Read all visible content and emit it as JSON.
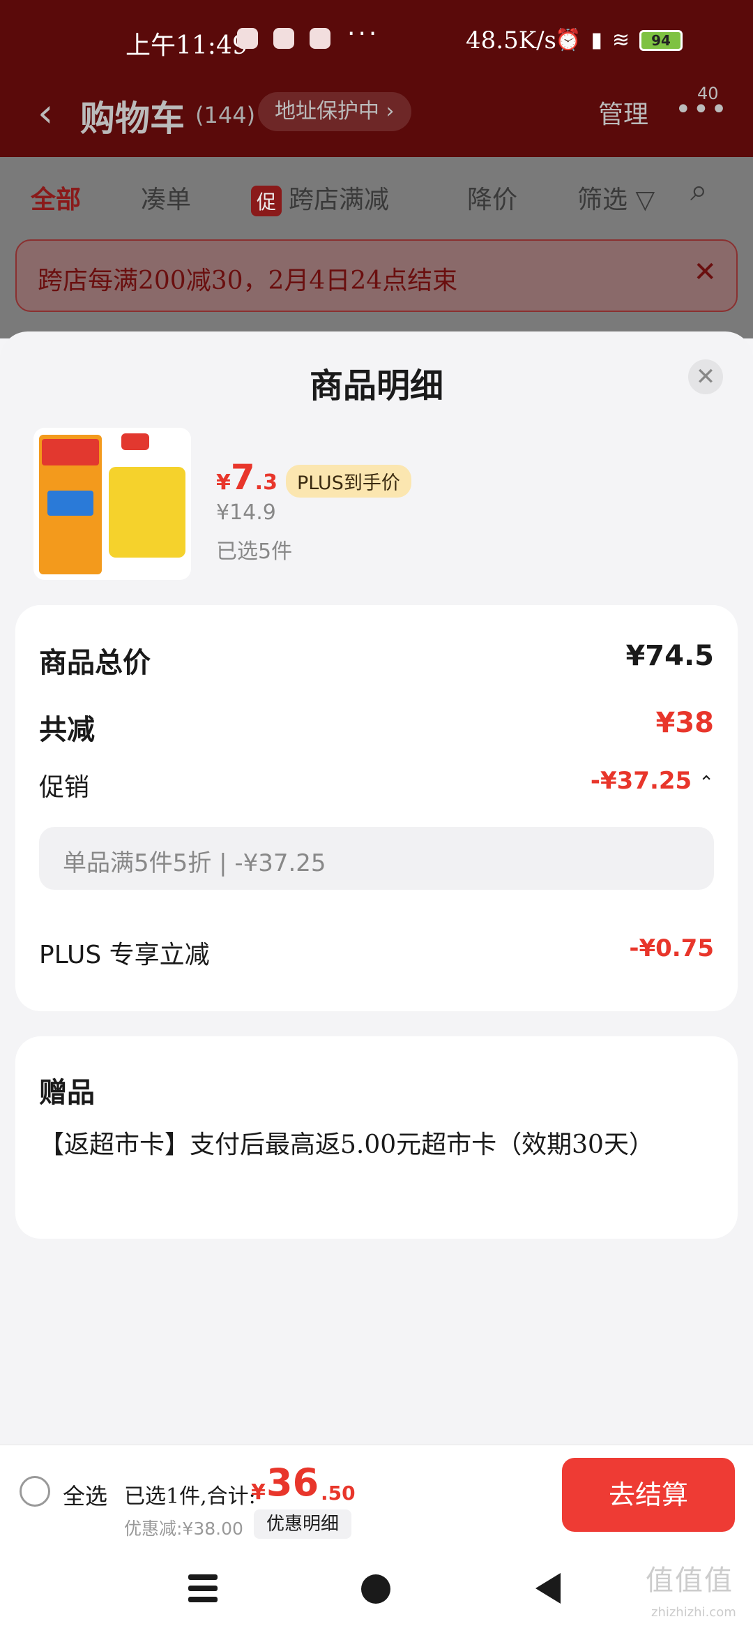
{
  "status_bar": {
    "time": "上午11:49",
    "more": "···",
    "net_speed": "48.5K/s",
    "battery": "94",
    "icons": [
      "app-icon",
      "app-icon",
      "app-icon",
      "alarm-icon",
      "signal-icon",
      "wifi-icon",
      "battery-icon"
    ]
  },
  "nav": {
    "back_icon": "chevron-left-icon",
    "title": "购物车",
    "count": "(144)",
    "address_protect": "地址保护中 ›",
    "manage": "管理",
    "more_dots": "•••",
    "badge": "40"
  },
  "tabs": [
    {
      "label": "全部",
      "active": true
    },
    {
      "label": "凑单"
    },
    {
      "label": "跨店满减",
      "tag": "促"
    },
    {
      "label": "降价"
    },
    {
      "label": "筛选 ▽"
    }
  ],
  "search_icon": "⌕",
  "promo_banner": {
    "text": "跨店每满200减30，2月4日24点结束",
    "close": "✕"
  },
  "sheet": {
    "title": "商品明细",
    "close": "✕",
    "product": {
      "price_symbol": "¥",
      "price_int": "7",
      "price_dec": ".3",
      "plus_tag": "PLUS到手价",
      "original_price": "¥14.9",
      "selected": "已选5件"
    },
    "summary": {
      "total_label": "商品总价",
      "total_value": "¥74.5",
      "reduce_label": "共减",
      "reduce_value": "¥38",
      "promo_label": "促销",
      "promo_value": "-¥37.25",
      "promo_caret": "⌃",
      "promo_detail": "单品满5件5折 | -¥37.25",
      "plus_label": "PLUS 专享立减",
      "plus_value": "-¥0.75"
    },
    "gift": {
      "title": "赠品",
      "text": "【返超市卡】支付后最高返5.00元超市卡（效期30天）"
    }
  },
  "checkout": {
    "select_all": "全选",
    "summary": "已选1件,合计:",
    "total_symbol": "¥",
    "total_int": "36",
    "total_dec": ".50",
    "discount": "优惠减:¥38.00",
    "discount_detail": "优惠明细",
    "checkout_button": "去结算"
  },
  "watermark": {
    "logo": "值值值",
    "url": "zhizhizhi.com"
  },
  "colors": {
    "accent_red": "#e8362b",
    "checkout_red": "#ee3b34",
    "plus_gold": "#fbe6b0",
    "header_dark_red": "#5a0a0a"
  }
}
